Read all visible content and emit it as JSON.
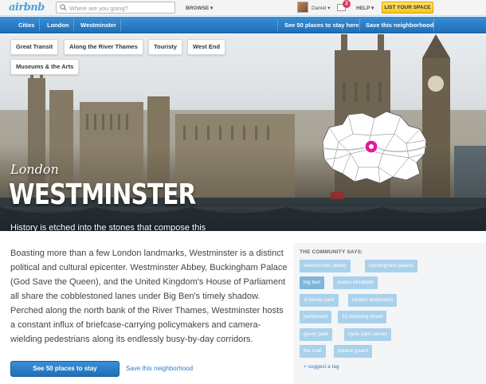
{
  "brand": {
    "logo": "airbnb"
  },
  "topbar": {
    "search_placeholder": "Where are you going?",
    "browse": "BROWSE ▾",
    "user_name": "Daniel ▾",
    "messages_count": "2",
    "help": "HELP ▾",
    "list_space": "LIST YOUR SPACE"
  },
  "nav": {
    "items": [
      "Cities",
      "London",
      "Westminster"
    ],
    "see_places": "See 50 places to stay here",
    "save": "Save this neighborhood"
  },
  "hero": {
    "tags": [
      "Great Transit",
      "Along the River Thames",
      "Touristy",
      "West End",
      "Museums & the Arts"
    ],
    "city": "London",
    "neighborhood": "WESTMINSTER",
    "tagline": "History is etched into the stones that compose this neighborhood's famous clock tower, abbey, and parliament buildings."
  },
  "main": {
    "description": "Boasting more than a few London landmarks, Westminster is a distinct political and cultural epicenter. Westminster Abbey, Buckingham Palace (God Save the Queen), and the United Kingdom's House of Parliament all share the cobblestoned lanes under Big Ben's timely shadow. Perched along the north bank of the River Thames, Westminster hosts a constant influx of briefcase-carrying policymakers and camera-wielding pedestrians along its endlessly busy-by-day corridors.",
    "cta": "See 50 places to stay",
    "save_link": "Save this neighborhood"
  },
  "community": {
    "title": "THE COMMUNITY SAYS:",
    "tags": [
      "westminster abbey",
      "buckingham palace",
      "big ben",
      "queen elizabeth",
      "st james park",
      "london landmarks",
      "parliament",
      "10 downing street",
      "green park",
      "hyde park corner",
      "the mall",
      "palace guard"
    ],
    "suggest": "+ suggest a tag"
  },
  "colors": {
    "accent": "#2f7dc6",
    "nav_blue": "#1f6fb8",
    "cta_yellow": "#f7c41f",
    "tag_blue": "#a9d1ec",
    "marker_pink": "#e8189a"
  }
}
